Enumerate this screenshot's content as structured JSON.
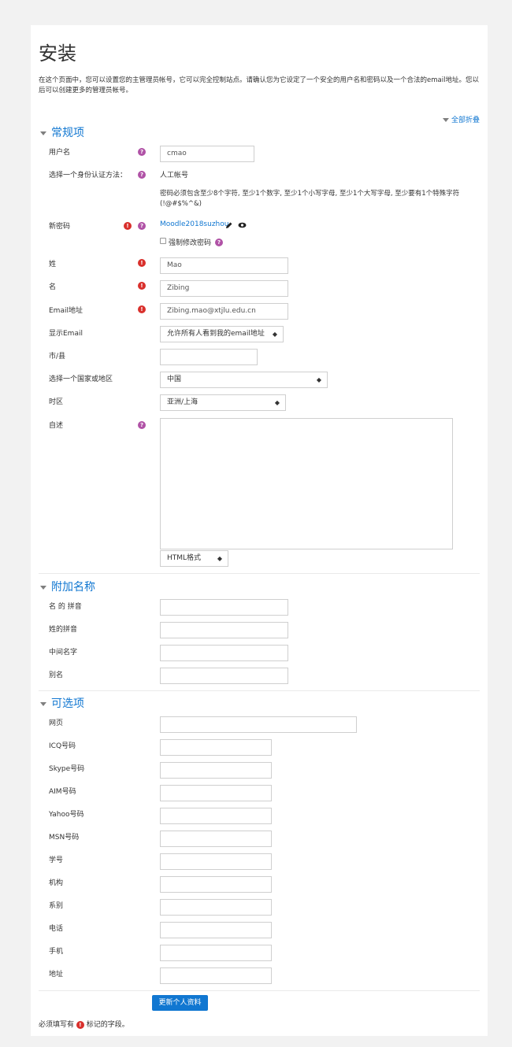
{
  "page_title": "安装",
  "intro": "在这个页面中，您可以设置您的主管理员帐号，它可以完全控制站点。请确认您为它设定了一个安全的用户名和密码以及一个合法的email地址。您以后可以创建更多的管理员帐号。",
  "collapse_all": "全部折叠",
  "sections": {
    "general": "常规项",
    "additional": "附加名称",
    "optional": "可选项"
  },
  "help_glyph": "?",
  "required_glyph": "!",
  "general": {
    "username_label": "用户名",
    "username_value": "cmao",
    "auth_label": "选择一个身份认证方法：",
    "auth_value": "人工帐号",
    "password_hint": "密码必须包含至少8个字符, 至少1个数字, 至少1个小写字母, 至少1个大写字母, 至少要有1个特殊字符 (!@#$%^&)",
    "newpassword_label": "新密码",
    "newpassword_value": "Moodle2018suzhou",
    "force_change_label": "强制修改密码",
    "surname_label": "姓",
    "surname_value": "Mao",
    "firstname_label": "名",
    "firstname_value": "Zibing",
    "email_label": "Email地址",
    "email_value": "Zibing.mao@xtjlu.edu.cn",
    "display_email_label": "显示Email",
    "display_email_value": "允许所有人看到我的email地址",
    "city_label": "市/县",
    "city_value": "",
    "country_label": "选择一个国家或地区",
    "country_value": "中国",
    "timezone_label": "时区",
    "timezone_value": "亚洲/上海",
    "description_label": "自述",
    "description_value": "",
    "format_value": "HTML格式"
  },
  "additional": {
    "firstname_phonetic_label": "名 的 拼音",
    "lastname_phonetic_label": "姓的拼音",
    "middlename_label": "中间名字",
    "alternatename_label": "别名"
  },
  "optional": {
    "webpage_label": "网页",
    "icq_label": "ICQ号码",
    "skype_label": "Skype号码",
    "aim_label": "AIM号码",
    "yahoo_label": "Yahoo号码",
    "msn_label": "MSN号码",
    "idnumber_label": "学号",
    "institution_label": "机构",
    "department_label": "系别",
    "phone_label": "电话",
    "mobile_label": "手机",
    "address_label": "地址"
  },
  "submit_label": "更新个人资料",
  "required_note_before": "必须填写有",
  "required_note_after": "标记的字段。",
  "colors": {
    "accent": "#1177d1",
    "help": "#b052a6",
    "required": "#d9302c"
  }
}
